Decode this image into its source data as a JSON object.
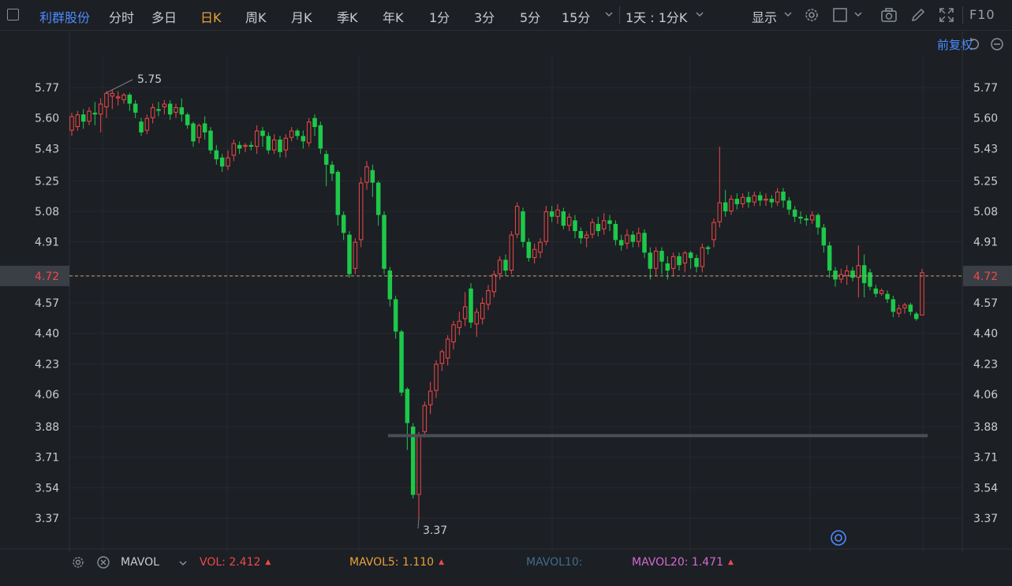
{
  "toolbar": {
    "stock_name": "利群股份",
    "periods": [
      "分时",
      "多日",
      "日K",
      "周K",
      "月K",
      "季K",
      "年K",
      "1分",
      "3分",
      "5分",
      "15分"
    ],
    "active_period": "日K",
    "period_select": "1天 : 1分K",
    "display_label": "显示",
    "f10_label": "F10"
  },
  "adjust_label": "前复权",
  "price_axis": {
    "ticks": [
      "5.77",
      "5.60",
      "5.43",
      "5.25",
      "5.08",
      "4.91",
      "4.72",
      "4.57",
      "4.40",
      "4.23",
      "4.06",
      "3.88",
      "3.71",
      "3.54",
      "3.37"
    ],
    "current_price": "4.72"
  },
  "annotations": {
    "high_label": "5.75",
    "low_label": "3.37"
  },
  "volume_bar": {
    "indicator": "MAVOL",
    "vol_label": "VOL:",
    "vol_value": "2.412",
    "mavol5_label": "MAVOL5:",
    "mavol5_value": "1.110",
    "mavol10_label": "MAVOL10:",
    "mavol20_label": "MAVOL20:",
    "mavol20_value": "1.471"
  },
  "colors": {
    "up": "#f04848",
    "down": "#1ec84a",
    "active_tab": "#e8a23a",
    "link": "#4d8cff",
    "mavol5": "#e8a23a",
    "mavol10": "#3d6d8a",
    "mavol20": "#d26ad2"
  },
  "chart_data": {
    "type": "candlestick",
    "ylim": [
      3.3,
      5.85
    ],
    "ticks": [
      5.77,
      5.6,
      5.43,
      5.25,
      5.08,
      4.91,
      4.72,
      4.57,
      4.4,
      4.23,
      4.06,
      3.88,
      3.71,
      3.54,
      3.37
    ],
    "current_price": 4.72,
    "high": 5.75,
    "low": 3.37,
    "support_level": 3.83,
    "candles": [
      [
        5.53,
        5.61,
        5.5,
        5.63
      ],
      [
        5.55,
        5.62,
        5.53,
        5.64
      ],
      [
        5.62,
        5.58,
        5.54,
        5.65
      ],
      [
        5.58,
        5.64,
        5.56,
        5.66
      ],
      [
        5.63,
        5.62,
        5.56,
        5.69
      ],
      [
        5.62,
        5.68,
        5.52,
        5.71
      ],
      [
        5.66,
        5.74,
        5.6,
        5.75
      ],
      [
        5.72,
        5.74,
        5.65,
        5.76
      ],
      [
        5.71,
        5.72,
        5.67,
        5.75
      ],
      [
        5.7,
        5.73,
        5.68,
        5.74
      ],
      [
        5.73,
        5.68,
        5.64,
        5.74
      ],
      [
        5.68,
        5.63,
        5.6,
        5.7
      ],
      [
        5.58,
        5.52,
        5.5,
        5.6
      ],
      [
        5.53,
        5.6,
        5.51,
        5.62
      ],
      [
        5.6,
        5.66,
        5.57,
        5.68
      ],
      [
        5.65,
        5.64,
        5.61,
        5.69
      ],
      [
        5.66,
        5.68,
        5.62,
        5.7
      ],
      [
        5.68,
        5.62,
        5.59,
        5.7
      ],
      [
        5.63,
        5.66,
        5.6,
        5.68
      ],
      [
        5.66,
        5.62,
        5.58,
        5.71
      ],
      [
        5.62,
        5.56,
        5.54,
        5.63
      ],
      [
        5.57,
        5.47,
        5.44,
        5.58
      ],
      [
        5.49,
        5.56,
        5.46,
        5.57
      ],
      [
        5.57,
        5.52,
        5.48,
        5.61
      ],
      [
        5.53,
        5.42,
        5.4,
        5.55
      ],
      [
        5.42,
        5.37,
        5.34,
        5.45
      ],
      [
        5.38,
        5.33,
        5.3,
        5.4
      ],
      [
        5.33,
        5.38,
        5.31,
        5.42
      ],
      [
        5.39,
        5.46,
        5.36,
        5.48
      ],
      [
        5.45,
        5.43,
        5.4,
        5.47
      ],
      [
        5.44,
        5.45,
        5.41,
        5.46
      ],
      [
        5.45,
        5.44,
        5.42,
        5.47
      ],
      [
        5.44,
        5.53,
        5.4,
        5.56
      ],
      [
        5.53,
        5.5,
        5.44,
        5.55
      ],
      [
        5.5,
        5.42,
        5.4,
        5.52
      ],
      [
        5.42,
        5.48,
        5.4,
        5.51
      ],
      [
        5.48,
        5.41,
        5.38,
        5.5
      ],
      [
        5.42,
        5.49,
        5.38,
        5.51
      ],
      [
        5.49,
        5.53,
        5.47,
        5.55
      ],
      [
        5.53,
        5.5,
        5.48,
        5.54
      ],
      [
        5.5,
        5.47,
        5.43,
        5.53
      ],
      [
        5.46,
        5.58,
        5.44,
        5.6
      ],
      [
        5.6,
        5.55,
        5.5,
        5.62
      ],
      [
        5.56,
        5.43,
        5.4,
        5.58
      ],
      [
        5.4,
        5.34,
        5.22,
        5.42
      ],
      [
        5.34,
        5.29,
        5.25,
        5.36
      ],
      [
        5.3,
        5.06,
        5.0,
        5.31
      ],
      [
        5.06,
        4.96,
        4.92,
        5.08
      ],
      [
        4.95,
        4.73,
        4.71,
        4.97
      ],
      [
        4.76,
        4.91,
        4.73,
        4.93
      ],
      [
        4.92,
        5.24,
        4.88,
        5.27
      ],
      [
        5.24,
        5.33,
        5.2,
        5.36
      ],
      [
        5.31,
        5.24,
        5.16,
        5.34
      ],
      [
        5.24,
        5.06,
        5.0,
        5.25
      ],
      [
        5.06,
        4.76,
        4.73,
        5.08
      ],
      [
        4.75,
        4.59,
        4.55,
        4.77
      ],
      [
        4.59,
        4.41,
        4.37,
        4.61
      ],
      [
        4.41,
        4.07,
        4.05,
        4.42
      ],
      [
        4.09,
        3.9,
        3.75,
        4.1
      ],
      [
        3.88,
        3.5,
        3.48,
        3.9
      ],
      [
        3.5,
        3.83,
        3.37,
        3.85
      ],
      [
        3.85,
        4.0,
        3.82,
        4.02
      ],
      [
        4.0,
        4.08,
        3.95,
        4.13
      ],
      [
        4.08,
        4.23,
        4.04,
        4.25
      ],
      [
        4.23,
        4.3,
        4.19,
        4.31
      ],
      [
        4.26,
        4.37,
        4.22,
        4.39
      ],
      [
        4.35,
        4.45,
        4.31,
        4.47
      ],
      [
        4.43,
        4.47,
        4.39,
        4.52
      ],
      [
        4.48,
        4.55,
        4.44,
        4.63
      ],
      [
        4.65,
        4.46,
        4.43,
        4.68
      ],
      [
        4.45,
        4.52,
        4.38,
        4.54
      ],
      [
        4.48,
        4.57,
        4.45,
        4.6
      ],
      [
        4.56,
        4.64,
        4.53,
        4.67
      ],
      [
        4.63,
        4.73,
        4.6,
        4.75
      ],
      [
        4.73,
        4.81,
        4.7,
        4.83
      ],
      [
        4.81,
        4.75,
        4.72,
        4.84
      ],
      [
        4.75,
        4.95,
        4.73,
        4.97
      ],
      [
        4.95,
        5.11,
        4.93,
        5.13
      ],
      [
        5.08,
        4.91,
        4.88,
        5.1
      ],
      [
        4.91,
        4.82,
        4.8,
        4.93
      ],
      [
        4.82,
        4.87,
        4.79,
        4.9
      ],
      [
        4.85,
        4.91,
        4.82,
        4.93
      ],
      [
        4.91,
        5.08,
        4.89,
        5.11
      ],
      [
        5.08,
        5.05,
        5.02,
        5.11
      ],
      [
        5.05,
        5.09,
        5.01,
        5.12
      ],
      [
        5.08,
        5.0,
        4.98,
        5.1
      ],
      [
        5.0,
        5.05,
        4.97,
        5.07
      ],
      [
        5.03,
        4.97,
        4.93,
        5.06
      ],
      [
        4.97,
        4.93,
        4.9,
        4.99
      ],
      [
        4.93,
        4.95,
        4.88,
        4.97
      ],
      [
        4.95,
        5.02,
        4.93,
        5.04
      ],
      [
        5.01,
        4.97,
        4.94,
        5.05
      ],
      [
        4.98,
        5.03,
        4.95,
        5.07
      ],
      [
        5.03,
        5.01,
        4.97,
        5.06
      ],
      [
        5.01,
        4.92,
        4.89,
        5.03
      ],
      [
        4.92,
        4.89,
        4.86,
        4.95
      ],
      [
        4.9,
        4.95,
        4.87,
        4.98
      ],
      [
        4.95,
        4.91,
        4.88,
        4.97
      ],
      [
        4.91,
        4.96,
        4.88,
        4.99
      ],
      [
        4.96,
        4.85,
        4.82,
        4.98
      ],
      [
        4.85,
        4.76,
        4.7,
        4.88
      ],
      [
        4.76,
        4.86,
        4.72,
        4.88
      ],
      [
        4.86,
        4.8,
        4.73,
        4.88
      ],
      [
        4.79,
        4.75,
        4.7,
        4.83
      ],
      [
        4.76,
        4.83,
        4.72,
        4.85
      ],
      [
        4.83,
        4.78,
        4.75,
        4.85
      ],
      [
        4.79,
        4.85,
        4.74,
        4.86
      ],
      [
        4.85,
        4.82,
        4.76,
        4.86
      ],
      [
        4.82,
        4.77,
        4.74,
        4.84
      ],
      [
        4.77,
        4.88,
        4.74,
        4.9
      ],
      [
        4.88,
        4.87,
        4.84,
        4.89
      ],
      [
        4.92,
        5.02,
        4.88,
        5.04
      ],
      [
        5.02,
        5.13,
        4.99,
        5.44
      ],
      [
        5.13,
        5.08,
        5.05,
        5.2
      ],
      [
        5.08,
        5.15,
        5.06,
        5.17
      ],
      [
        5.15,
        5.12,
        5.09,
        5.18
      ],
      [
        5.12,
        5.16,
        5.1,
        5.18
      ],
      [
        5.16,
        5.13,
        5.1,
        5.19
      ],
      [
        5.13,
        5.17,
        5.11,
        5.19
      ],
      [
        5.17,
        5.14,
        5.11,
        5.19
      ],
      [
        5.14,
        5.15,
        5.11,
        5.18
      ],
      [
        5.15,
        5.13,
        5.1,
        5.17
      ],
      [
        5.13,
        5.19,
        5.11,
        5.21
      ],
      [
        5.19,
        5.14,
        5.1,
        5.21
      ],
      [
        5.14,
        5.09,
        5.06,
        5.16
      ],
      [
        5.09,
        5.05,
        5.02,
        5.11
      ],
      [
        5.05,
        5.04,
        5.01,
        5.08
      ],
      [
        5.04,
        5.03,
        5.0,
        5.06
      ],
      [
        5.03,
        5.06,
        5.01,
        5.08
      ],
      [
        5.06,
        4.99,
        4.95,
        5.07
      ],
      [
        4.99,
        4.89,
        4.85,
        5.01
      ],
      [
        4.89,
        4.75,
        4.71,
        4.91
      ],
      [
        4.75,
        4.7,
        4.66,
        4.77
      ],
      [
        4.7,
        4.73,
        4.68,
        4.76
      ],
      [
        4.72,
        4.75,
        4.67,
        4.78
      ],
      [
        4.75,
        4.71,
        4.69,
        4.77
      ],
      [
        4.71,
        4.78,
        4.6,
        4.89
      ],
      [
        4.78,
        4.68,
        4.6,
        4.84
      ],
      [
        4.74,
        4.66,
        4.64,
        4.76
      ],
      [
        4.65,
        4.62,
        4.6,
        4.67
      ],
      [
        4.62,
        4.64,
        4.61,
        4.65
      ],
      [
        4.62,
        4.59,
        4.57,
        4.64
      ],
      [
        4.59,
        4.52,
        4.49,
        4.61
      ],
      [
        4.51,
        4.54,
        4.49,
        4.56
      ],
      [
        4.54,
        4.56,
        4.51,
        4.57
      ],
      [
        4.56,
        4.52,
        4.5,
        4.57
      ],
      [
        4.51,
        4.48,
        4.47,
        4.52
      ],
      [
        4.5,
        4.74,
        4.5,
        4.76
      ]
    ]
  }
}
